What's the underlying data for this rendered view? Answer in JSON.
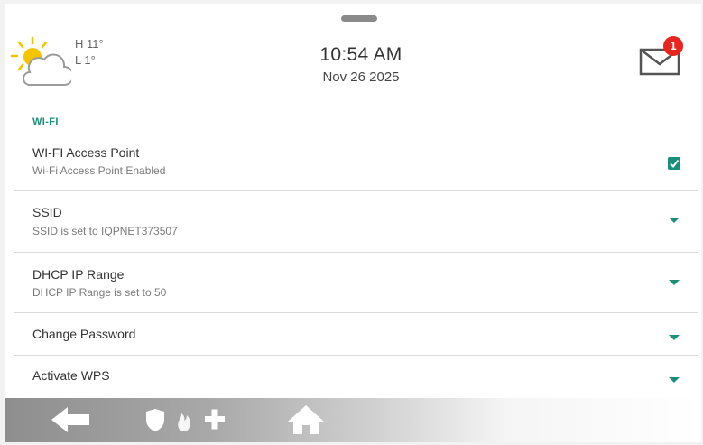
{
  "header": {
    "weather": {
      "icon": "partly-sunny-icon",
      "high": "H 11°",
      "low": "L 1°"
    },
    "time": "10:54 AM",
    "date": "Nov 26 2025",
    "messages": {
      "icon": "envelope-icon",
      "count": "1"
    }
  },
  "section": {
    "title": "WI-FI"
  },
  "settings": [
    {
      "title": "WI-FI Access Point",
      "subtitle": "Wi-Fi Access Point Enabled",
      "control": "checkbox",
      "checked": true
    },
    {
      "title": "SSID",
      "subtitle": "SSID is set to IQPNET373507",
      "control": "dropdown"
    },
    {
      "title": "DHCP IP Range",
      "subtitle": "DHCP IP Range is set to 50",
      "control": "dropdown"
    },
    {
      "title": "Change Password",
      "subtitle": "",
      "control": "dropdown"
    },
    {
      "title": "Activate WPS",
      "subtitle": "",
      "control": "dropdown"
    }
  ],
  "navbar": {
    "items": [
      {
        "icon": "back-arrow-icon"
      },
      {
        "icon": "emergency-icon"
      },
      {
        "icon": "home-icon"
      }
    ]
  },
  "colors": {
    "accent": "#1a8f7a",
    "badge": "#e8251f",
    "sun": "#f5c400"
  }
}
